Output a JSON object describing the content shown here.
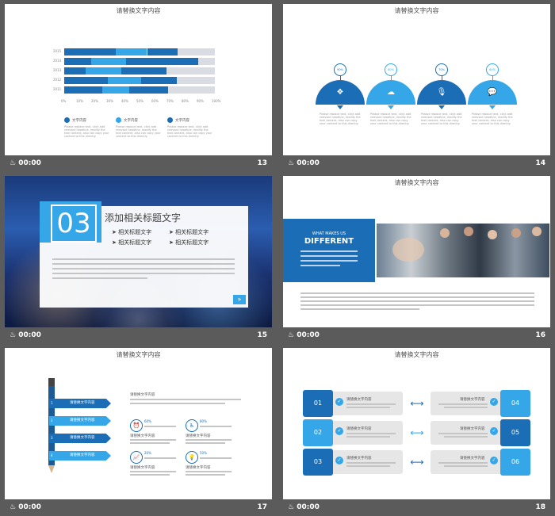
{
  "footer": {
    "time_prefix": "♨",
    "time": "00:00"
  },
  "slides": [
    {
      "number": "13",
      "title": "请替换文字内容"
    },
    {
      "number": "14",
      "title": "请替换文字内容"
    },
    {
      "number": "15"
    },
    {
      "number": "16",
      "title": "请替换文字内容"
    },
    {
      "number": "17",
      "title": "请替换文字内容"
    },
    {
      "number": "18",
      "title": "请替换文字内容"
    }
  ],
  "s13": {
    "years": [
      "2015",
      "2014",
      "2013",
      "2012",
      "2011"
    ],
    "ticks": [
      "0%",
      "10%",
      "20%",
      "30%",
      "40%",
      "50%",
      "60%",
      "70%",
      "80%",
      "90%",
      "100%"
    ],
    "legend": [
      "文字内容",
      "文字内容",
      "文字内容"
    ],
    "body": "Please replace text, click add relevant headline, modify the text content, also can copy your content to this directly.",
    "chart_data": {
      "type": "bar",
      "categories": [
        "2015",
        "2014",
        "2013",
        "2012",
        "2011"
      ],
      "series": [
        {
          "name": "文字内容",
          "values": [
            34,
            18,
            14,
            29,
            25
          ]
        },
        {
          "name": "文字内容",
          "values": [
            21,
            23,
            24,
            22,
            18
          ]
        },
        {
          "name": "文字内容",
          "values": [
            20,
            48,
            30,
            24,
            26
          ]
        }
      ],
      "xlim": [
        0,
        100
      ]
    }
  },
  "s14": {
    "percents": [
      "90%",
      "80%",
      "70%",
      "60%"
    ],
    "icons": [
      "dropbox-icon",
      "cloud-upload-icon",
      "microphone-icon",
      "chat-icon"
    ],
    "body": "Please replace text, click add relevant headline, modify the text content, also can copy your content to this directly."
  },
  "s15": {
    "number": "03",
    "heading": "添加相关标题文字",
    "items": [
      "相关标题文字",
      "相关标题文字",
      "相关标题文字",
      "相关标题文字"
    ]
  },
  "s16": {
    "what": "WHAT MAKES US",
    "different": "DIFFERENT"
  },
  "s17": {
    "steps": [
      "请替换文字内容",
      "请替换文字内容",
      "请替换文字内容",
      "请替换文字内容"
    ],
    "heading": "请替换文字内容",
    "stats": [
      {
        "pct": "60%",
        "label": "请替换文字内容",
        "icon": "alarm-clock-icon"
      },
      {
        "pct": "80%",
        "label": "请替换文字内容",
        "icon": "wheelchair-icon"
      },
      {
        "pct": "20%",
        "label": "请替换文字内容",
        "icon": "chart-icon"
      },
      {
        "pct": "50%",
        "label": "请替换文字内容",
        "icon": "lightbulb-icon"
      }
    ]
  },
  "s18": {
    "left": [
      {
        "num": "01",
        "label": "请替换文字内容"
      },
      {
        "num": "02",
        "label": "请替换文字内容"
      },
      {
        "num": "03",
        "label": "请替换文字内容"
      }
    ],
    "right": [
      {
        "num": "04",
        "label": "请替换文字内容"
      },
      {
        "num": "05",
        "label": "请替换文字内容"
      },
      {
        "num": "06",
        "label": "请替换文字内容"
      }
    ]
  },
  "colors": {
    "dark_blue": "#1b6eb5",
    "light_blue": "#35a7e8",
    "background": "#5b5b5b"
  }
}
